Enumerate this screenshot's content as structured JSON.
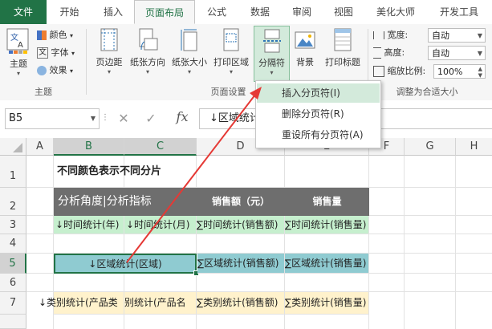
{
  "ribbon_tabs": [
    {
      "label": "文件"
    },
    {
      "label": "开始"
    },
    {
      "label": "插入"
    },
    {
      "label": "页面布局"
    },
    {
      "label": "公式"
    },
    {
      "label": "数据"
    },
    {
      "label": "审阅"
    },
    {
      "label": "视图"
    },
    {
      "label": "美化大师"
    },
    {
      "label": "开发工具"
    }
  ],
  "theme_group": {
    "theme_label": "主题",
    "colors_label": "颜色",
    "fonts_label": "字体",
    "effects_label": "效果",
    "group_label": "主题"
  },
  "page_setup": {
    "margins": "页边距",
    "orientation": "纸张方向",
    "size": "纸张大小",
    "print_area": "打印区域",
    "breaks": "分隔符",
    "background": "背景",
    "print_titles": "打印标题",
    "group_label": "页面设置"
  },
  "scale_group": {
    "width_label": "宽度:",
    "width_value": "自动",
    "height_label": "高度:",
    "height_value": "自动",
    "scale_label": "缩放比例:",
    "scale_value": "100%",
    "group_label": "调整为合适大小"
  },
  "breaks_menu": {
    "items": [
      {
        "label": "插入分页符(I)"
      },
      {
        "label": "删除分页符(R)"
      },
      {
        "label": "重设所有分页符(A)"
      }
    ]
  },
  "formula_bar": {
    "name_box": "B5",
    "cancel_glyph": "✕",
    "enter_glyph": "✓",
    "fx": "fx",
    "content": "↓区域统计"
  },
  "columns": [
    "A",
    "B",
    "C",
    "D",
    "E",
    "F",
    "G",
    "H"
  ],
  "rows": [
    "1",
    "2",
    "3",
    "4",
    "5",
    "6",
    "7"
  ],
  "sheet": {
    "title": "不同颜色表示不同分片",
    "header_merged": "分析角度|分析指标",
    "header_sales": "销售额（元）",
    "header_qty": "销售量",
    "r3_b": "↓时间统计(年)",
    "r3_c": "↓时间统计(月)",
    "r3_d": "∑时间统计(销售额)",
    "r3_e": "∑时间统计(销售量)",
    "r5_bc": "↓区域统计(区域)",
    "r5_d": "∑区域统计(销售额)",
    "r5_e": "∑区域统计(销售量)",
    "r7_a": "↓类别统计(产品类",
    "r7_c": "别统计(产品名",
    "r7_d": "∑类别统计(销售额)",
    "r7_e": "∑类别统计(销售量)"
  },
  "colors": {
    "excel_green": "#217346",
    "header_gray": "#6e6e6e",
    "green_fill": "#c6efce",
    "teal_fill": "#8fcbd1",
    "yellow_fill": "#fff2cc",
    "arrow_red": "#e53935"
  }
}
